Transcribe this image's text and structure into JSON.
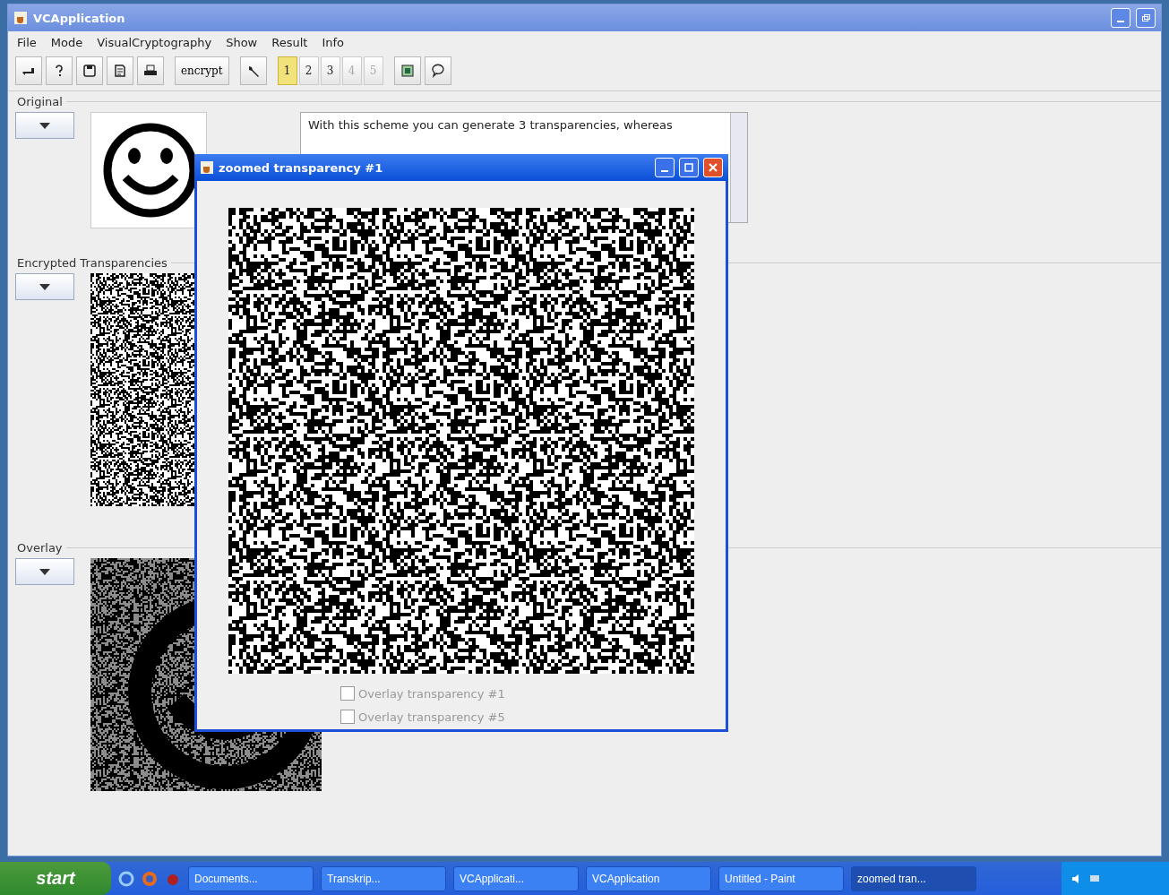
{
  "window": {
    "title": "VCApplication"
  },
  "menu": [
    "File",
    "Mode",
    "VisualCryptography",
    "Show",
    "Result",
    "Info"
  ],
  "toolbar": {
    "encrypt_label": "encrypt",
    "pages": [
      {
        "label": "1",
        "selected": true,
        "disabled": false
      },
      {
        "label": "2",
        "selected": false,
        "disabled": false
      },
      {
        "label": "3",
        "selected": false,
        "disabled": false
      },
      {
        "label": "4",
        "selected": false,
        "disabled": true
      },
      {
        "label": "5",
        "selected": false,
        "disabled": true
      }
    ]
  },
  "sections": [
    {
      "title": "Original",
      "kind": "original"
    },
    {
      "title": "Encrypted Transparencies",
      "kind": "noise"
    },
    {
      "title": "Overlay",
      "kind": "overlay"
    }
  ],
  "description": "With this scheme you can generate 3 transparencies, whereas",
  "zoom_window": {
    "title": "zoomed transparency #1",
    "checkboxes": [
      {
        "label": "Overlay transparency #1",
        "checked": false
      },
      {
        "label": "Overlay transparency #5",
        "checked": false
      }
    ]
  },
  "taskbar": {
    "start": "start",
    "tasks": [
      {
        "label": "Documents...",
        "selected": false
      },
      {
        "label": "Transkrip...",
        "selected": false
      },
      {
        "label": "VCApplicati...",
        "selected": false
      },
      {
        "label": "VCApplication",
        "selected": false
      },
      {
        "label": "Untitled - Paint",
        "selected": false
      },
      {
        "label": "zoomed tran...",
        "selected": true
      }
    ]
  }
}
